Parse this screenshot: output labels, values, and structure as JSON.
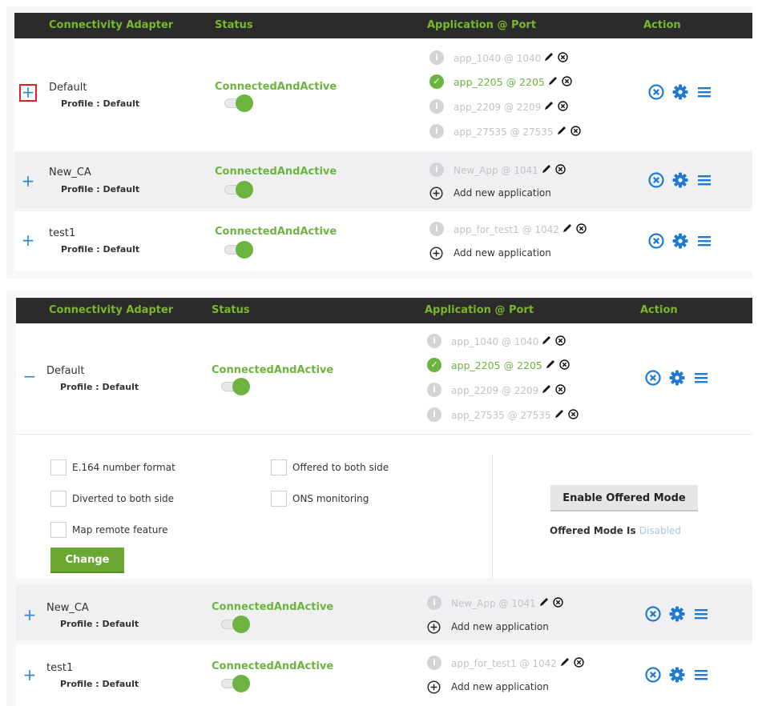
{
  "colors": {
    "header_bg": "#2b2b2b",
    "header_text": "#7ab829",
    "status_green": "#6db33f",
    "expander_blue": "#2e88d8",
    "action_blue": "#1f7ad6",
    "disabled_text": "#a9c7e6"
  },
  "headers": {
    "connectivity_adapter": "Connectivity Adapter",
    "status": "Status",
    "application_port": "Application @ Port",
    "action": "Action"
  },
  "icons": {
    "expand": "plus-icon",
    "collapse": "minus-icon",
    "info": "info-circle-icon",
    "active": "check-circle-icon",
    "edit": "pencil-icon",
    "remove": "x-circle-icon",
    "add": "plus-circle-icon",
    "delete_ca": "x-circle-icon",
    "settings": "gear-icon",
    "menu": "hamburger-menu-icon"
  },
  "panel1": {
    "rows": [
      {
        "name": "Default",
        "profile": "Profile : Default",
        "expander": "+",
        "status": "ConnectedAndActive",
        "apps": [
          {
            "label": "app_1040 @ 1040",
            "active": false
          },
          {
            "label": "app_2205 @ 2205",
            "active": true
          },
          {
            "label": "app_2209 @ 2209",
            "active": false
          },
          {
            "label": "app_27535 @ 27535",
            "active": false
          }
        ]
      },
      {
        "name": "New_CA",
        "profile": "Profile : Default",
        "expander": "+",
        "status": "ConnectedAndActive",
        "apps": [
          {
            "label": "New_App @ 1041",
            "active": false
          }
        ],
        "add_label": "Add new application"
      },
      {
        "name": "test1",
        "profile": "Profile : Default",
        "expander": "+",
        "status": "ConnectedAndActive",
        "apps": [
          {
            "label": "app_for_test1 @ 1042",
            "active": false
          }
        ],
        "add_label": "Add new application"
      }
    ]
  },
  "panel2": {
    "rows": [
      {
        "name": "Default",
        "profile": "Profile : Default",
        "expander": "−",
        "status": "ConnectedAndActive",
        "apps": [
          {
            "label": "app_1040 @ 1040",
            "active": false
          },
          {
            "label": "app_2205 @ 2205",
            "active": true
          },
          {
            "label": "app_2209 @ 2209",
            "active": false
          },
          {
            "label": "app_27535 @ 27535",
            "active": false
          }
        ]
      },
      {
        "name": "New_CA",
        "profile": "Profile : Default",
        "expander": "+",
        "status": "ConnectedAndActive",
        "apps": [
          {
            "label": "New_App @ 1041",
            "active": false
          }
        ],
        "add_label": "Add new application"
      },
      {
        "name": "test1",
        "profile": "Profile : Default",
        "expander": "+",
        "status": "ConnectedAndActive",
        "apps": [
          {
            "label": "app_for_test1 @ 1042",
            "active": false
          }
        ],
        "add_label": "Add new application"
      }
    ],
    "details": {
      "options": [
        {
          "label": "E.164 number format",
          "checked": false
        },
        {
          "label": "Offered to both side",
          "checked": false
        },
        {
          "label": "Diverted to both side",
          "checked": false
        },
        {
          "label": "ONS monitoring",
          "checked": false
        },
        {
          "label": "Map remote feature",
          "checked": false
        }
      ],
      "change_label": "Change",
      "enable_offered_label": "Enable Offered Mode",
      "offered_mode_prefix": "Offered Mode Is",
      "offered_mode_value": "Disabled"
    }
  }
}
